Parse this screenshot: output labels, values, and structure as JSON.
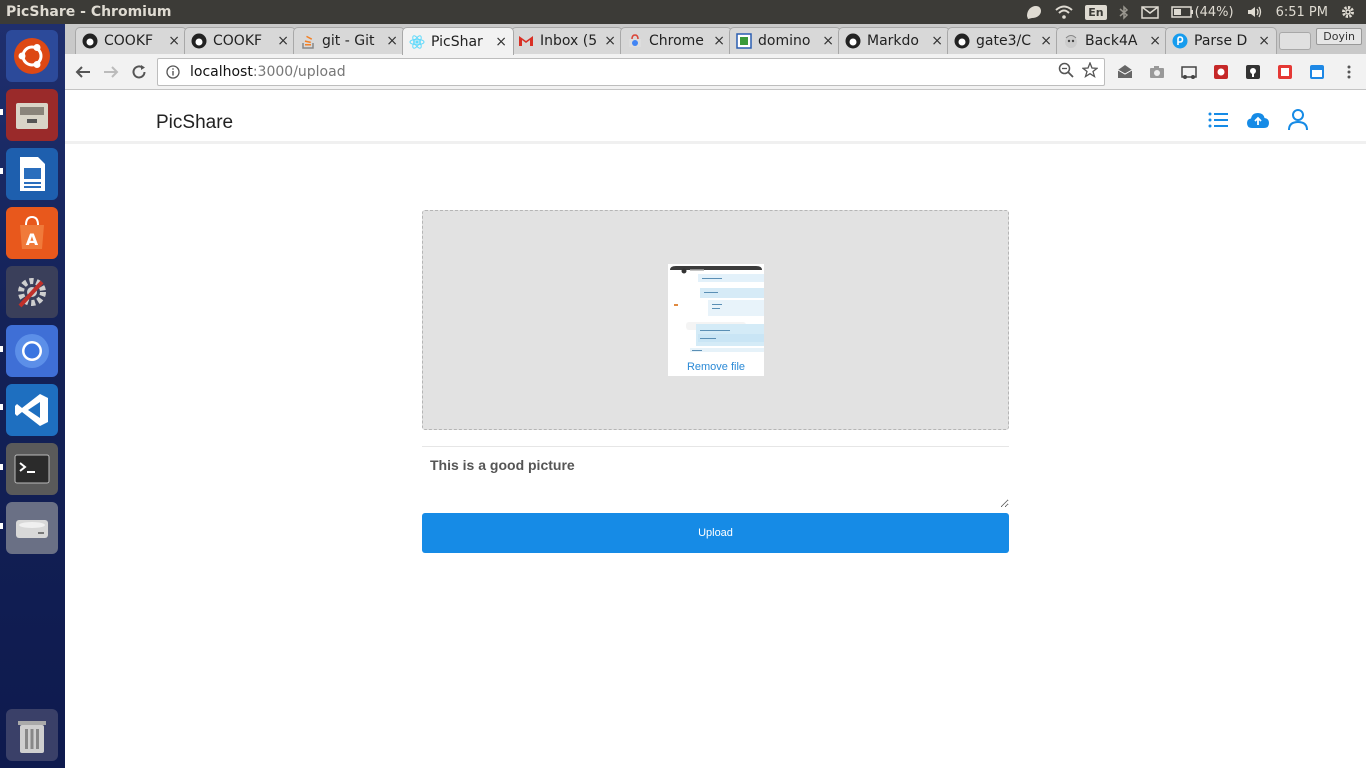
{
  "os": {
    "window_title": "PicShare - Chromium",
    "keyboard_layout": "En",
    "battery": "(44%)",
    "clock": "6:51 PM"
  },
  "browser": {
    "tabs": [
      {
        "label": "COOKF",
        "icon": "github-icon"
      },
      {
        "label": "COOKF",
        "icon": "github-icon"
      },
      {
        "label": "git - Git",
        "icon": "stackoverflow-icon"
      },
      {
        "label": "PicShar",
        "icon": "react-icon",
        "active": true
      },
      {
        "label": "Inbox (5",
        "icon": "gmail-icon"
      },
      {
        "label": "Chrome",
        "icon": "chrome-webstore-icon"
      },
      {
        "label": "domino",
        "icon": "domino-icon"
      },
      {
        "label": "Markdo",
        "icon": "github-icon"
      },
      {
        "label": "gate3/C",
        "icon": "github-icon"
      },
      {
        "label": "Back4A",
        "icon": "back4app-icon"
      },
      {
        "label": "Parse D",
        "icon": "parse-icon"
      }
    ],
    "profile": "Doyin",
    "url_host": "localhost",
    "url_path": ":3000/upload"
  },
  "app": {
    "brand": "PicShare",
    "nav_icons": [
      "list-icon",
      "cloud-upload-icon",
      "user-icon"
    ],
    "dropzone": {
      "remove_label": "Remove file"
    },
    "caption": {
      "value": "This is a good picture"
    },
    "upload_label": "Upload"
  },
  "colors": {
    "accent": "#168be6",
    "link": "#2a89d6",
    "dropzone_bg": "#e2e2e2"
  }
}
